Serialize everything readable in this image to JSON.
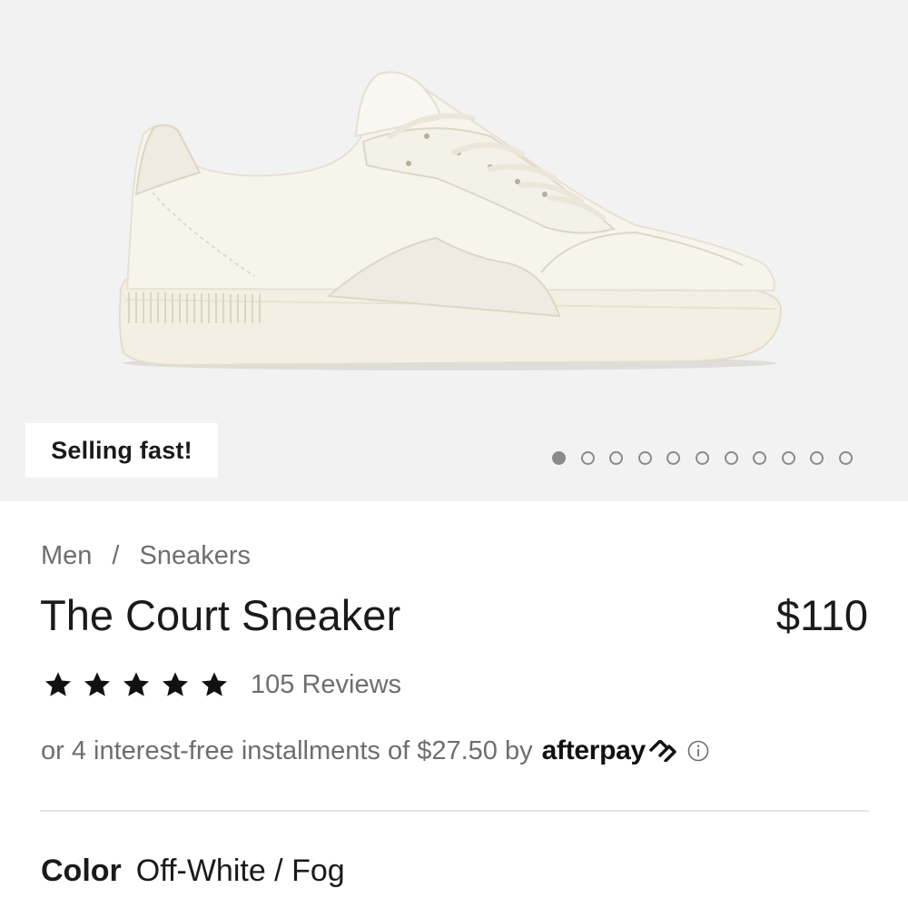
{
  "hero": {
    "badge": "Selling fast!",
    "image": "white-leather-sneaker",
    "carousel": {
      "total": 11,
      "active": 1
    },
    "background": "#f2f2f2"
  },
  "breadcrumb": {
    "items": [
      "Men",
      "Sneakers"
    ],
    "separator": "/"
  },
  "product": {
    "title": "The Court Sneaker",
    "price": "$110",
    "rating": {
      "stars": 5,
      "reviews": "105 Reviews",
      "star_icon": "star-icon"
    }
  },
  "installments": {
    "text": "or 4 interest-free installments of $27.50 by",
    "provider": "afterpay",
    "provider_icon": "afterpay-loop-icon",
    "info_icon": "info-icon"
  },
  "color": {
    "label": "Color",
    "value": "Off-White / Fog"
  }
}
